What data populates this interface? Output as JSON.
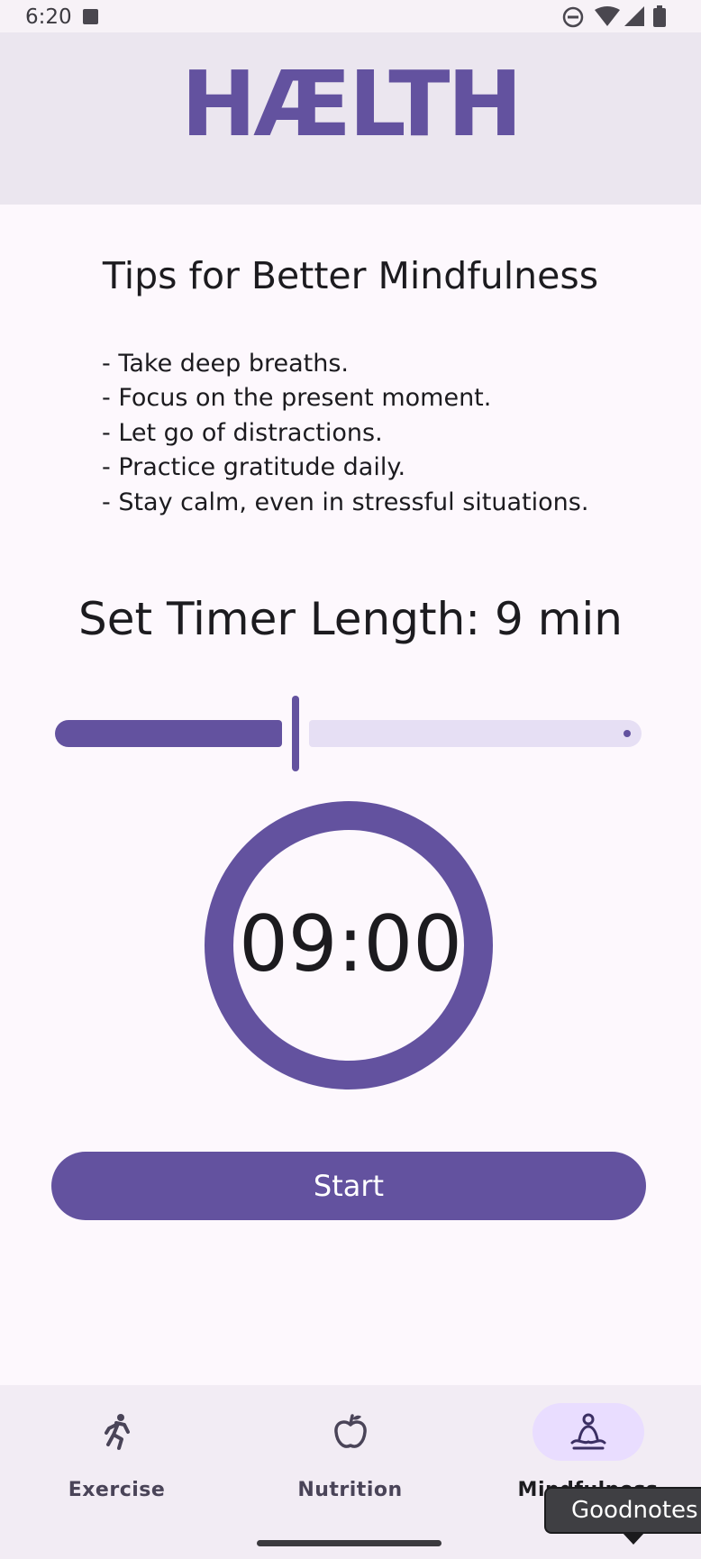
{
  "status_bar": {
    "time": "6:20",
    "icons": [
      "keyboard-a-icon",
      "do-not-disturb-icon",
      "wifi-icon",
      "signal-icon",
      "battery-icon"
    ]
  },
  "header": {
    "logo_text": "HÆLTH"
  },
  "tips": {
    "title": "Tips for Better Mindfulness",
    "items": [
      "- Take deep breaths.",
      "- Focus on the present moment.",
      "- Let go of distractions.",
      "- Practice gratitude daily.",
      "- Stay calm, even in stressful situations."
    ]
  },
  "timer": {
    "label": "Set Timer Length: 9 min",
    "slider_value_fraction": 0.41,
    "display": "09:00",
    "start_label": "Start"
  },
  "bottom_nav": {
    "items": [
      {
        "label": "Exercise",
        "icon": "running-person-icon",
        "active": false
      },
      {
        "label": "Nutrition",
        "icon": "apple-icon",
        "active": false
      },
      {
        "label": "Mindfulness",
        "icon": "meditation-icon",
        "active": true
      }
    ]
  },
  "tooltip": {
    "text": "Goodnotes"
  },
  "colors": {
    "accent": "#63529f",
    "header_bg": "#ebe6ef",
    "page_bg": "#fdf8fd",
    "nav_bg": "#f2ecf4",
    "active_pill": "#e9ddff",
    "slider_track_inactive": "#e6dff4"
  }
}
